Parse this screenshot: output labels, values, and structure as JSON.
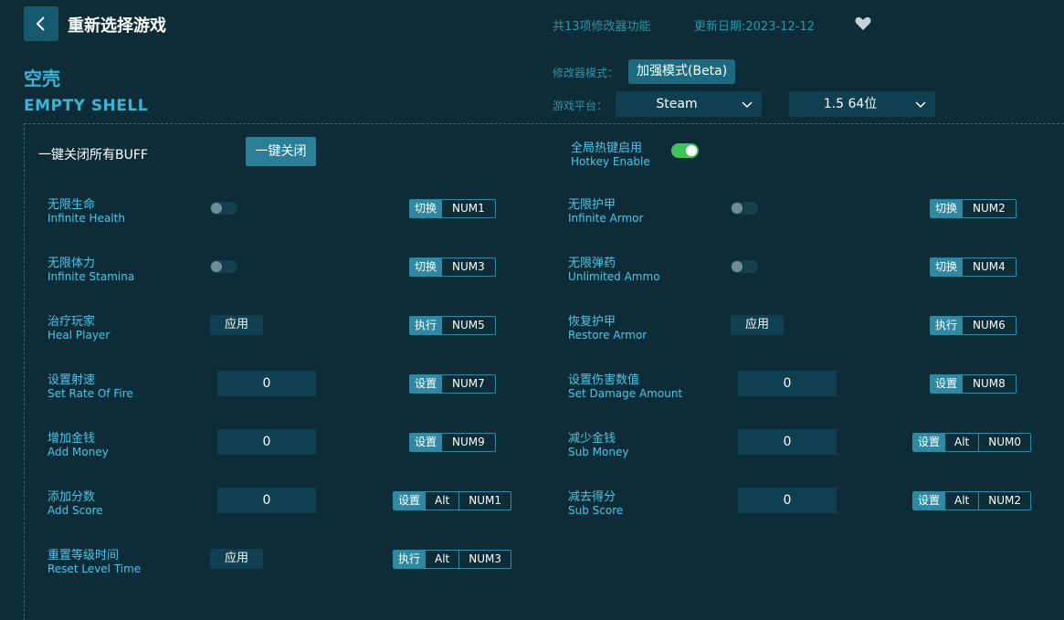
{
  "header": {
    "title": "重新选择游戏",
    "feature_count": "共13项修改器功能",
    "update_date": "更新日期:2023-12-12"
  },
  "game": {
    "name_cn": "空壳",
    "name_en": "EMPTY SHELL"
  },
  "settings": {
    "mode_label": "修改器模式：",
    "mode_value": "加强模式(Beta)",
    "platform_label": "游戏平台：",
    "platform_value": "Steam",
    "version_value": "1.5 64位"
  },
  "global": {
    "all_off_label": "一键关闭所有BUFF",
    "all_off_button": "一键关闭",
    "hotkey_cn": "全局热键启用",
    "hotkey_en": "Hotkey Enable",
    "hotkey_enabled": true
  },
  "cheats": {
    "infinite_health": {
      "cn": "无限生命",
      "en": "Infinite Health",
      "action": "切换",
      "key": "NUM1"
    },
    "infinite_armor": {
      "cn": "无限护甲",
      "en": "Infinite Armor",
      "action": "切换",
      "key": "NUM2"
    },
    "infinite_stamina": {
      "cn": "无限体力",
      "en": "Infinite Stamina",
      "action": "切换",
      "key": "NUM3"
    },
    "unlimited_ammo": {
      "cn": "无限弹药",
      "en": "Unlimited Ammo",
      "action": "切换",
      "key": "NUM4"
    },
    "heal_player": {
      "cn": "治疗玩家",
      "en": "Heal Player",
      "button": "应用",
      "action": "执行",
      "key": "NUM5"
    },
    "restore_armor": {
      "cn": "恢复护甲",
      "en": "Restore Armor",
      "button": "应用",
      "action": "执行",
      "key": "NUM6"
    },
    "set_rate_of_fire": {
      "cn": "设置射速",
      "en": "Set Rate Of Fire",
      "value": "0",
      "action": "设置",
      "key": "NUM7"
    },
    "set_damage_amount": {
      "cn": "设置伤害数值",
      "en": "Set Damage Amount",
      "value": "0",
      "action": "设置",
      "key": "NUM8"
    },
    "add_money": {
      "cn": "增加金钱",
      "en": "Add Money",
      "value": "0",
      "action": "设置",
      "key": "NUM9"
    },
    "sub_money": {
      "cn": "减少金钱",
      "en": "Sub Money",
      "value": "0",
      "action": "设置",
      "modifier": "Alt",
      "key": "NUM0"
    },
    "add_score": {
      "cn": "添加分数",
      "en": "Add Score",
      "value": "0",
      "action": "设置",
      "modifier": "Alt",
      "key": "NUM1"
    },
    "sub_score": {
      "cn": "减去得分",
      "en": "Sub Score",
      "value": "0",
      "action": "设置",
      "modifier": "Alt",
      "key": "NUM2"
    },
    "reset_level_time": {
      "cn": "重置等级时间",
      "en": "Reset Level Time",
      "button": "应用",
      "action": "执行",
      "modifier": "Alt",
      "key": "NUM3"
    }
  },
  "icons": [
    "back-arrow-icon",
    "heart-icon",
    "chevron-down-icon"
  ],
  "colors": {
    "background": "#0d2c38",
    "accent": "#38b6d8",
    "toggle_on": "#3ec45a"
  }
}
